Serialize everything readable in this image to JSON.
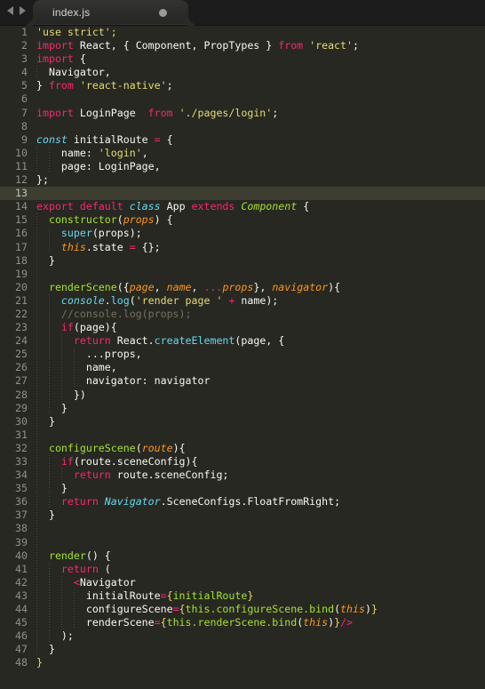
{
  "window": {
    "title": "index.js",
    "theme_background": "#272822",
    "gutter_color": "#8f908a",
    "active_line_background": "#3e3d32"
  },
  "tab_bar": {
    "nav_back_icon": "triangle-left-icon",
    "nav_forward_icon": "triangle-right-icon",
    "tabs": [
      {
        "label": "index.js",
        "dirty": true,
        "active": true
      }
    ]
  },
  "editor": {
    "language": "javascript",
    "active_line": 13,
    "first_line": 1,
    "last_line": 48,
    "lines": [
      {
        "n": "1",
        "tokens": [
          {
            "t": "'use strict';",
            "c": "t-str"
          }
        ]
      },
      {
        "n": "2",
        "tokens": [
          {
            "t": "import",
            "c": "t-kw"
          },
          {
            "t": " React, { Component, PropTypes } ",
            "c": "t-plain"
          },
          {
            "t": "from",
            "c": "t-kw"
          },
          {
            "t": " ",
            "c": "t-plain"
          },
          {
            "t": "'react'",
            "c": "t-str"
          },
          {
            "t": ";",
            "c": "t-plain"
          }
        ]
      },
      {
        "n": "3",
        "tokens": [
          {
            "t": "import",
            "c": "t-kw"
          },
          {
            "t": " {",
            "c": "t-plain"
          }
        ]
      },
      {
        "n": "4",
        "tokens": [
          {
            "t": "  Navigator,",
            "c": "t-plain"
          }
        ]
      },
      {
        "n": "5",
        "tokens": [
          {
            "t": "} ",
            "c": "t-plain"
          },
          {
            "t": "from",
            "c": "t-kw"
          },
          {
            "t": " ",
            "c": "t-plain"
          },
          {
            "t": "'react-native'",
            "c": "t-str"
          },
          {
            "t": ";",
            "c": "t-plain"
          }
        ]
      },
      {
        "n": "6",
        "tokens": []
      },
      {
        "n": "7",
        "tokens": [
          {
            "t": "import",
            "c": "t-kw"
          },
          {
            "t": " LoginPage  ",
            "c": "t-plain"
          },
          {
            "t": "from",
            "c": "t-kw"
          },
          {
            "t": " ",
            "c": "t-plain"
          },
          {
            "t": "'./pages/login'",
            "c": "t-str"
          },
          {
            "t": ";",
            "c": "t-plain"
          }
        ]
      },
      {
        "n": "8",
        "tokens": []
      },
      {
        "n": "9",
        "tokens": [
          {
            "t": "const",
            "c": "t-kw2"
          },
          {
            "t": " initialRoute ",
            "c": "t-plain"
          },
          {
            "t": "=",
            "c": "t-op"
          },
          {
            "t": " {",
            "c": "t-plain"
          }
        ]
      },
      {
        "n": "10",
        "tokens": [
          {
            "t": "    name: ",
            "c": "t-plain"
          },
          {
            "t": "'login'",
            "c": "t-str"
          },
          {
            "t": ",",
            "c": "t-plain"
          }
        ]
      },
      {
        "n": "11",
        "tokens": [
          {
            "t": "    page: LoginPage,",
            "c": "t-plain"
          }
        ]
      },
      {
        "n": "12",
        "tokens": [
          {
            "t": "};",
            "c": "t-plain"
          }
        ]
      },
      {
        "n": "13",
        "tokens": []
      },
      {
        "n": "14",
        "tokens": [
          {
            "t": "export default",
            "c": "t-kw"
          },
          {
            "t": " ",
            "c": "t-plain"
          },
          {
            "t": "class",
            "c": "t-kw2"
          },
          {
            "t": " App ",
            "c": "t-plain"
          },
          {
            "t": "extends",
            "c": "t-kw"
          },
          {
            "t": " ",
            "c": "t-plain"
          },
          {
            "t": "Component",
            "c": "t-type"
          },
          {
            "t": " {",
            "c": "t-plain"
          }
        ]
      },
      {
        "n": "15",
        "tokens": [
          {
            "t": "  ",
            "c": "t-plain"
          },
          {
            "t": "constructor",
            "c": "t-fn"
          },
          {
            "t": "(",
            "c": "t-plain"
          },
          {
            "t": "props",
            "c": "t-param"
          },
          {
            "t": ") {",
            "c": "t-plain"
          }
        ]
      },
      {
        "n": "16",
        "tokens": [
          {
            "t": "    ",
            "c": "t-plain"
          },
          {
            "t": "super",
            "c": "t-blue"
          },
          {
            "t": "(props);",
            "c": "t-plain"
          }
        ]
      },
      {
        "n": "17",
        "tokens": [
          {
            "t": "    ",
            "c": "t-plain"
          },
          {
            "t": "this",
            "c": "t-param"
          },
          {
            "t": ".state ",
            "c": "t-plain"
          },
          {
            "t": "=",
            "c": "t-op"
          },
          {
            "t": " {};",
            "c": "t-plain"
          }
        ]
      },
      {
        "n": "18",
        "tokens": [
          {
            "t": "  }",
            "c": "t-plain"
          }
        ]
      },
      {
        "n": "19",
        "tokens": []
      },
      {
        "n": "20",
        "tokens": [
          {
            "t": "  ",
            "c": "t-plain"
          },
          {
            "t": "renderScene",
            "c": "t-fn"
          },
          {
            "t": "({",
            "c": "t-plain"
          },
          {
            "t": "page",
            "c": "t-param"
          },
          {
            "t": ", ",
            "c": "t-plain"
          },
          {
            "t": "name",
            "c": "t-param"
          },
          {
            "t": ", ",
            "c": "t-plain"
          },
          {
            "t": "...",
            "c": "t-op"
          },
          {
            "t": "props",
            "c": "t-param"
          },
          {
            "t": "}, ",
            "c": "t-plain"
          },
          {
            "t": "navigator",
            "c": "t-param"
          },
          {
            "t": "){",
            "c": "t-plain"
          }
        ]
      },
      {
        "n": "21",
        "tokens": [
          {
            "t": "    ",
            "c": "t-plain"
          },
          {
            "t": "console",
            "c": "t-kw2"
          },
          {
            "t": ".",
            "c": "t-plain"
          },
          {
            "t": "log",
            "c": "t-blue"
          },
          {
            "t": "(",
            "c": "t-plain"
          },
          {
            "t": "'render page '",
            "c": "t-str"
          },
          {
            "t": " ",
            "c": "t-plain"
          },
          {
            "t": "+",
            "c": "t-op"
          },
          {
            "t": " name);",
            "c": "t-plain"
          }
        ]
      },
      {
        "n": "22",
        "tokens": [
          {
            "t": "    //console.log(props);",
            "c": "t-comment"
          }
        ]
      },
      {
        "n": "23",
        "tokens": [
          {
            "t": "    ",
            "c": "t-plain"
          },
          {
            "t": "if",
            "c": "t-kw"
          },
          {
            "t": "(page){",
            "c": "t-plain"
          }
        ]
      },
      {
        "n": "24",
        "tokens": [
          {
            "t": "      ",
            "c": "t-plain"
          },
          {
            "t": "return",
            "c": "t-kw"
          },
          {
            "t": " React.",
            "c": "t-plain"
          },
          {
            "t": "createElement",
            "c": "t-blue"
          },
          {
            "t": "(page, {",
            "c": "t-plain"
          }
        ]
      },
      {
        "n": "25",
        "tokens": [
          {
            "t": "        ...props,",
            "c": "t-plain"
          }
        ]
      },
      {
        "n": "26",
        "tokens": [
          {
            "t": "        name,",
            "c": "t-plain"
          }
        ]
      },
      {
        "n": "27",
        "tokens": [
          {
            "t": "        navigator: navigator",
            "c": "t-plain"
          }
        ]
      },
      {
        "n": "28",
        "tokens": [
          {
            "t": "      })",
            "c": "t-plain"
          }
        ]
      },
      {
        "n": "29",
        "tokens": [
          {
            "t": "    }",
            "c": "t-plain"
          }
        ]
      },
      {
        "n": "30",
        "tokens": [
          {
            "t": "  }",
            "c": "t-plain"
          }
        ]
      },
      {
        "n": "31",
        "tokens": []
      },
      {
        "n": "32",
        "tokens": [
          {
            "t": "  ",
            "c": "t-plain"
          },
          {
            "t": "configureScene",
            "c": "t-fn"
          },
          {
            "t": "(",
            "c": "t-plain"
          },
          {
            "t": "route",
            "c": "t-param"
          },
          {
            "t": "){",
            "c": "t-plain"
          }
        ]
      },
      {
        "n": "33",
        "tokens": [
          {
            "t": "    ",
            "c": "t-plain"
          },
          {
            "t": "if",
            "c": "t-kw"
          },
          {
            "t": "(route.sceneConfig){",
            "c": "t-plain"
          }
        ]
      },
      {
        "n": "34",
        "tokens": [
          {
            "t": "      ",
            "c": "t-plain"
          },
          {
            "t": "return",
            "c": "t-kw"
          },
          {
            "t": " route.sceneConfig;",
            "c": "t-plain"
          }
        ]
      },
      {
        "n": "35",
        "tokens": [
          {
            "t": "    }",
            "c": "t-plain"
          }
        ]
      },
      {
        "n": "36",
        "tokens": [
          {
            "t": "    ",
            "c": "t-plain"
          },
          {
            "t": "return",
            "c": "t-kw"
          },
          {
            "t": " ",
            "c": "t-plain"
          },
          {
            "t": "Navigator",
            "c": "t-kw2"
          },
          {
            "t": ".SceneConfigs.FloatFromRight;",
            "c": "t-plain"
          }
        ]
      },
      {
        "n": "37",
        "tokens": [
          {
            "t": "  }",
            "c": "t-plain"
          }
        ]
      },
      {
        "n": "38",
        "tokens": []
      },
      {
        "n": "39",
        "tokens": []
      },
      {
        "n": "40",
        "tokens": [
          {
            "t": "  ",
            "c": "t-plain"
          },
          {
            "t": "render",
            "c": "t-fn"
          },
          {
            "t": "() {",
            "c": "t-plain"
          }
        ]
      },
      {
        "n": "41",
        "tokens": [
          {
            "t": "    ",
            "c": "t-plain"
          },
          {
            "t": "return",
            "c": "t-kw"
          },
          {
            "t": " (",
            "c": "t-plain"
          }
        ]
      },
      {
        "n": "42",
        "tokens": [
          {
            "t": "      ",
            "c": "t-plain"
          },
          {
            "t": "<",
            "c": "t-op"
          },
          {
            "t": "Navigator",
            "c": "t-plain"
          }
        ]
      },
      {
        "n": "43",
        "tokens": [
          {
            "t": "        initialRoute",
            "c": "t-plain"
          },
          {
            "t": "=",
            "c": "t-op"
          },
          {
            "t": "{",
            "c": "t-brace"
          },
          {
            "t": "initialRoute",
            "c": "t-fn"
          },
          {
            "t": "}",
            "c": "t-brace"
          }
        ]
      },
      {
        "n": "44",
        "tokens": [
          {
            "t": "        configureScene",
            "c": "t-plain"
          },
          {
            "t": "=",
            "c": "t-op"
          },
          {
            "t": "{",
            "c": "t-brace"
          },
          {
            "t": "this.configureScene.bind",
            "c": "t-fn"
          },
          {
            "t": "(",
            "c": "t-plain"
          },
          {
            "t": "this",
            "c": "t-param"
          },
          {
            "t": ")",
            "c": "t-plain"
          },
          {
            "t": "}",
            "c": "t-brace"
          }
        ]
      },
      {
        "n": "45",
        "tokens": [
          {
            "t": "        renderScene",
            "c": "t-plain"
          },
          {
            "t": "=",
            "c": "t-op"
          },
          {
            "t": "{",
            "c": "t-brace"
          },
          {
            "t": "this.renderScene.bind",
            "c": "t-fn"
          },
          {
            "t": "(",
            "c": "t-plain"
          },
          {
            "t": "this",
            "c": "t-param"
          },
          {
            "t": ")",
            "c": "t-plain"
          },
          {
            "t": "}",
            "c": "t-brace"
          },
          {
            "t": "/>",
            "c": "t-op"
          }
        ]
      },
      {
        "n": "46",
        "tokens": [
          {
            "t": "    );",
            "c": "t-plain"
          }
        ]
      },
      {
        "n": "47",
        "tokens": [
          {
            "t": "  }",
            "c": "t-plain"
          }
        ]
      },
      {
        "n": "48",
        "tokens": [
          {
            "t": "}",
            "c": "t-brace"
          }
        ]
      }
    ]
  }
}
